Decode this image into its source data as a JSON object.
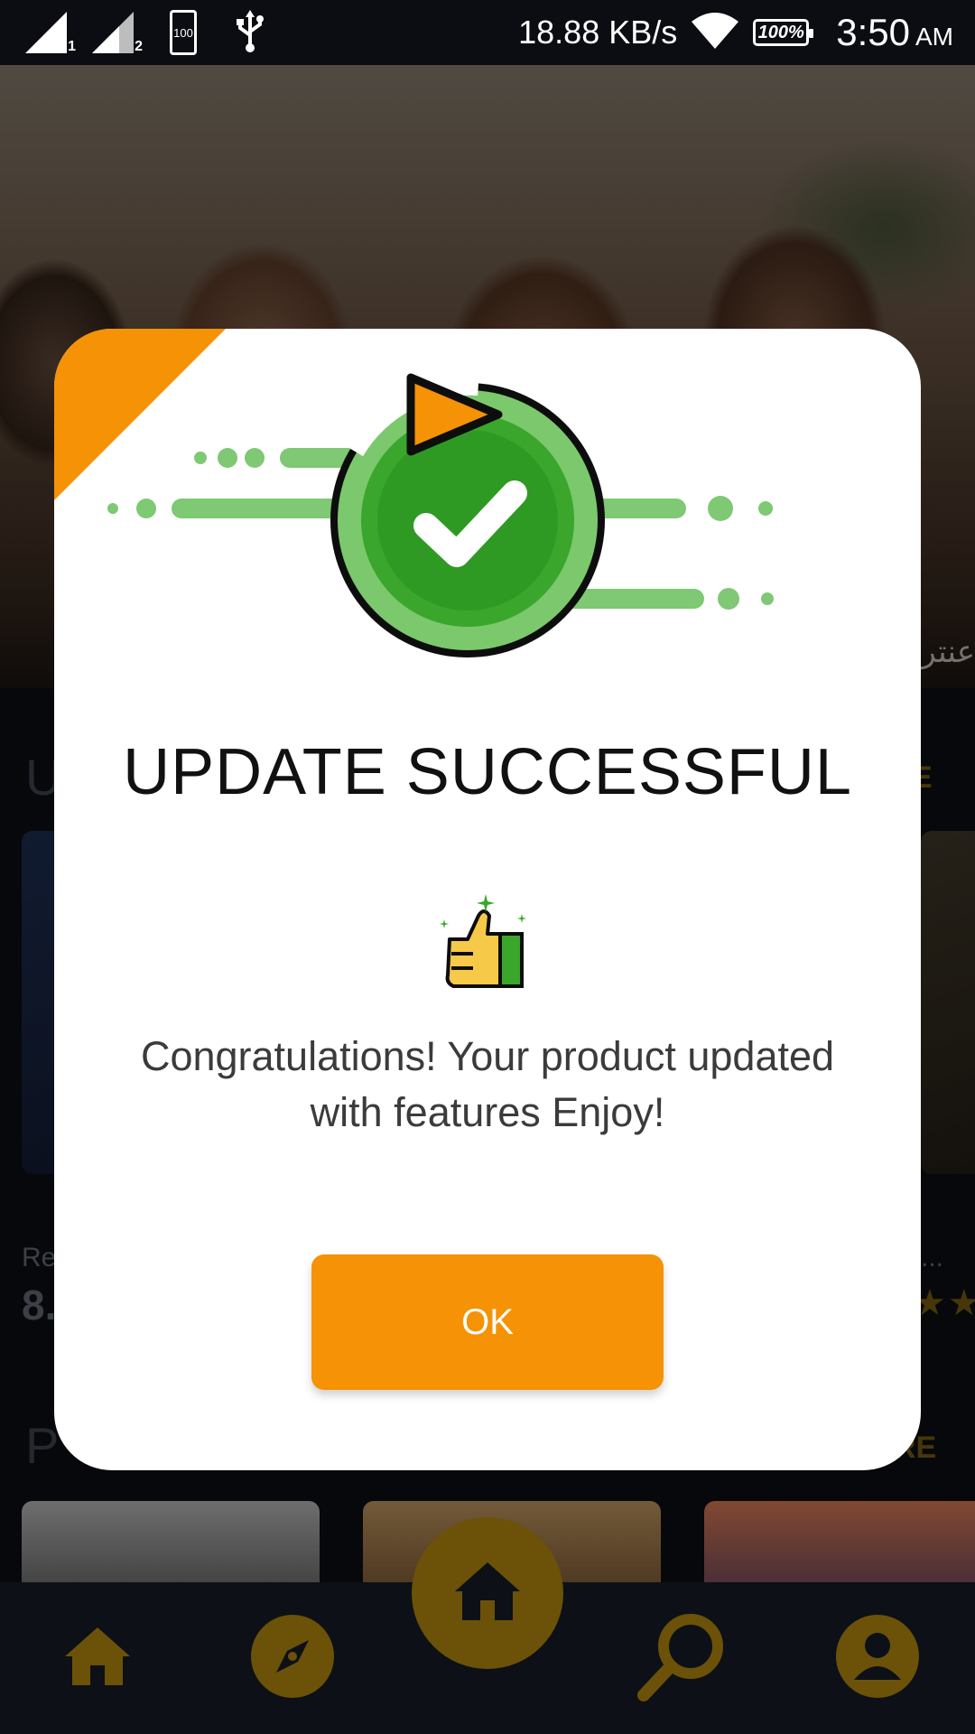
{
  "status_bar": {
    "sim1_label": "1",
    "sim2_label": "2",
    "battery_icon_label": "100",
    "net_speed": "18.88 KB/s",
    "battery_percent": "100%",
    "time": "3:50",
    "ampm": "AM"
  },
  "background": {
    "hero_caption": "عنتر",
    "section1_more": "E",
    "section1_title": "U",
    "card_title_left": "Re",
    "card_rating_left": "8.",
    "card_title_right": "...",
    "section2_title": "P",
    "section2_more": "RE"
  },
  "dialog": {
    "title": "UPDATE SUCCESSFUL",
    "message": "Congratulations! Your product updated with features Enjoy!",
    "ok_label": "OK",
    "accent_color": "#f59205",
    "success_color": "#3aa62b"
  },
  "bottom_nav": {
    "items": [
      {
        "icon": "home-icon"
      },
      {
        "icon": "compass-icon"
      },
      {
        "icon": "home-icon"
      },
      {
        "icon": "search-icon"
      },
      {
        "icon": "profile-icon"
      }
    ],
    "active_color": "#6b5208"
  }
}
